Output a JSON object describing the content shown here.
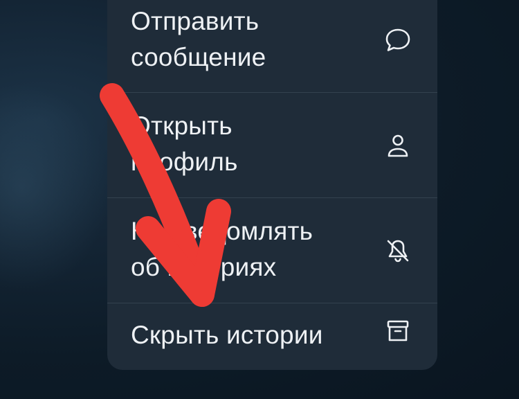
{
  "menu": {
    "items": [
      {
        "label_line1": "Отправить",
        "label_line2": "сообщение",
        "icon": "message-bubble-icon"
      },
      {
        "label_line1": "Открыть",
        "label_line2": "профиль",
        "icon": "person-icon"
      },
      {
        "label_line1": "Не уведомлять",
        "label_line2": "об историях",
        "icon": "bell-off-icon"
      },
      {
        "label": "Скрыть истории",
        "icon": "archive-box-icon"
      }
    ]
  },
  "annotation": {
    "arrow_color": "#ee3b34"
  }
}
